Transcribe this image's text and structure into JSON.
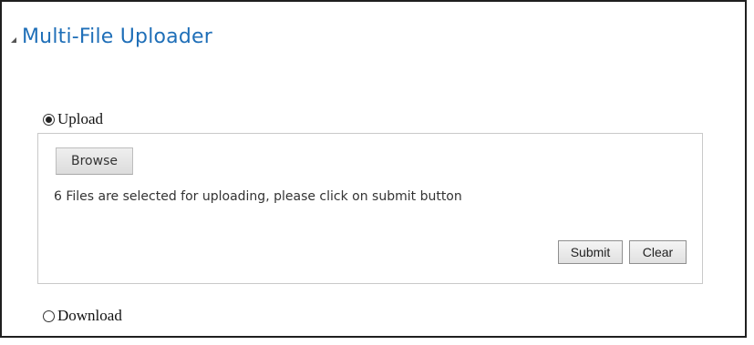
{
  "header": {
    "title": "Multi-File Uploader",
    "collapse_icon": "triangle-expanded-icon"
  },
  "mode": {
    "options": [
      {
        "label": "Upload",
        "selected": true
      },
      {
        "label": "Download",
        "selected": false
      }
    ]
  },
  "upload_panel": {
    "browse_label": "Browse",
    "status_text": "6 Files are selected for uploading, please click on submit button",
    "submit_label": "Submit",
    "clear_label": "Clear"
  },
  "colors": {
    "title": "#1f6fb8",
    "panel_border": "#c9c9c9"
  }
}
